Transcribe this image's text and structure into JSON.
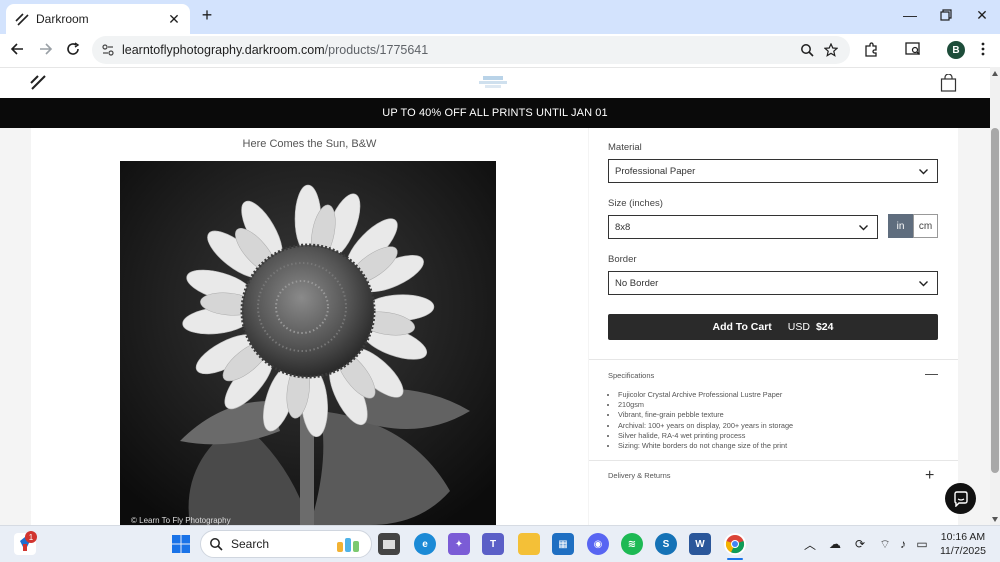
{
  "browser": {
    "tab_title": "Darkroom",
    "url_main": "learntoflyphotography.darkroom.com",
    "url_path": "/products/1775641",
    "profile_initial": "B"
  },
  "site": {
    "promo_text": "UP TO 40% OFF ALL PRINTS UNTIL JAN 01"
  },
  "product": {
    "title": "Here Comes the Sun, B&W",
    "credit": "© Learn To Fly Photography",
    "material_label": "Material",
    "material_value": "Professional Paper",
    "size_label": "Size (inches)",
    "size_value": "8x8",
    "unit_in": "in",
    "unit_cm": "cm",
    "border_label": "Border",
    "border_value": "No Border",
    "add_to_cart": "Add To Cart",
    "currency": "USD",
    "price": "$24",
    "specs_title": "Specifications",
    "specs": [
      "Fujicolor Crystal Archive Professional Lustre Paper",
      "210gsm",
      "Vibrant, fine-grain pebble texture",
      "Archival: 100+ years on display, 200+ years in storage",
      "Silver halide, RA-4 wet printing process",
      "Sizing: White borders do not change size of the print"
    ],
    "delivery_title": "Delivery & Returns"
  },
  "taskbar": {
    "search_label": "Search",
    "time": "10:16 AM",
    "date": "11/7/2025",
    "notification_count": "1"
  },
  "colors": {
    "tab_strip": "#d3e3fd",
    "promo_bg": "#0a0a0a",
    "unit_active": "#5f6d7e",
    "button_bg": "#2a2a2a"
  }
}
